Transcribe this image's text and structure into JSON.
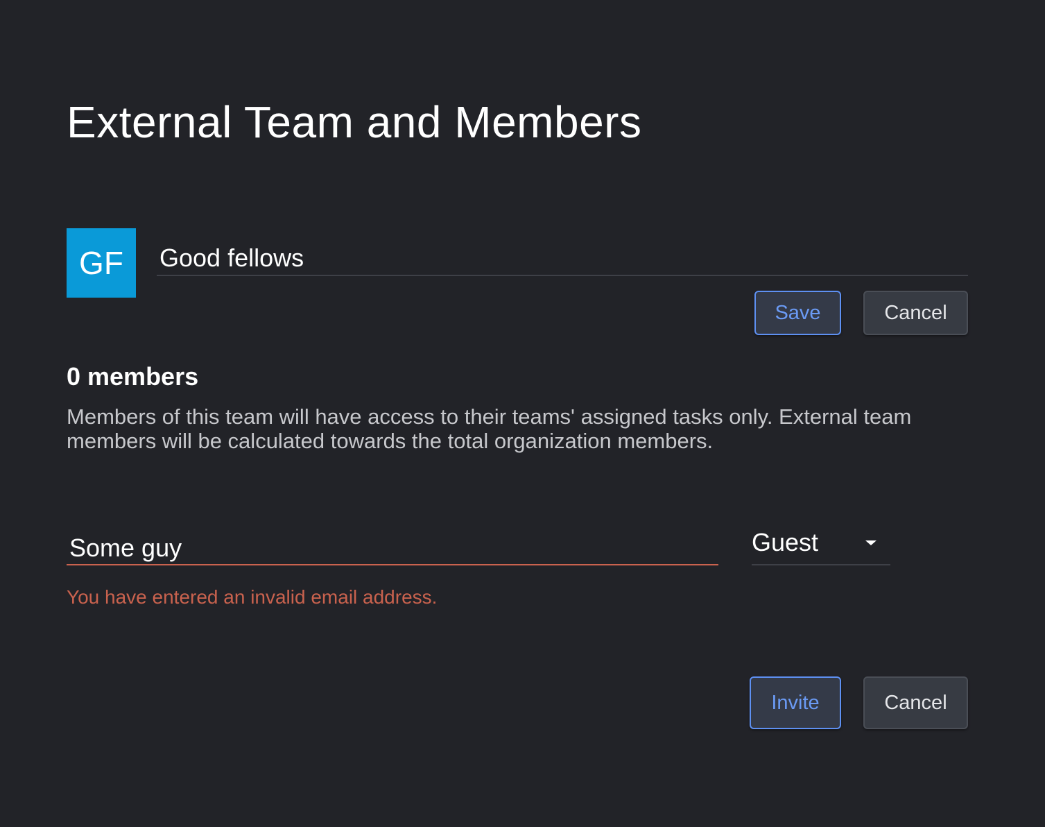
{
  "page": {
    "title": "External Team and Members"
  },
  "team": {
    "avatar_initials": "GF",
    "avatar_color": "#0a9ad8",
    "name_value": "Good fellows",
    "save_label": "Save",
    "cancel_label": "Cancel"
  },
  "members": {
    "count_label": "0 members",
    "description": "Members of this team will have access to their teams' assigned tasks only. External team members will be calculated towards the total organization members."
  },
  "invite": {
    "email_value": "Some guy",
    "role_value": "Guest",
    "error_message": "You have entered an invalid email address.",
    "error_color": "#c9624e",
    "invite_label": "Invite",
    "cancel_label": "Cancel"
  },
  "colors": {
    "background": "#222328",
    "accent": "#5e90f2"
  }
}
